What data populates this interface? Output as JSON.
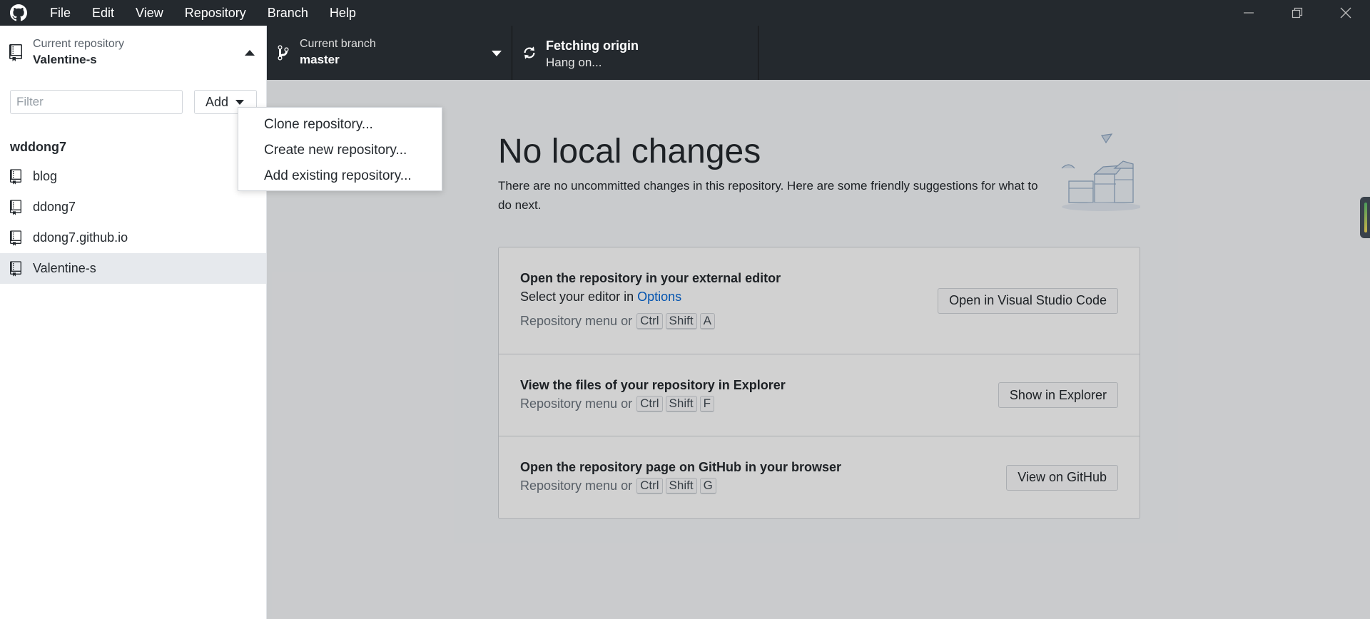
{
  "menu": [
    "File",
    "Edit",
    "View",
    "Repository",
    "Branch",
    "Help"
  ],
  "toolbar": {
    "repo_label": "Current repository",
    "repo_value": "Valentine-s",
    "branch_label": "Current branch",
    "branch_value": "master",
    "fetch_title": "Fetching origin",
    "fetch_sub": "Hang on..."
  },
  "sidebar": {
    "filter_placeholder": "Filter",
    "add_label": "Add",
    "group": "wddong7",
    "repos": [
      "blog",
      "ddong7",
      "ddong7.github.io",
      "Valentine-s"
    ],
    "selected": "Valentine-s"
  },
  "dropdown": [
    "Clone repository...",
    "Create new repository...",
    "Add existing repository..."
  ],
  "main": {
    "title": "No local changes",
    "description": "There are no uncommitted changes in this repository. Here are some friendly suggestions for what to do next.",
    "suggestions": [
      {
        "title": "Open the repository in your external editor",
        "sub_prefix": "Select your editor in ",
        "sub_link": "Options",
        "hint": "Repository menu or",
        "keys": [
          "Ctrl",
          "Shift",
          "A"
        ],
        "button": "Open in Visual Studio Code"
      },
      {
        "title": "View the files of your repository in Explorer",
        "hint": "Repository menu or",
        "keys": [
          "Ctrl",
          "Shift",
          "F"
        ],
        "button": "Show in Explorer"
      },
      {
        "title": "Open the repository page on GitHub in your browser",
        "hint": "Repository menu or",
        "keys": [
          "Ctrl",
          "Shift",
          "G"
        ],
        "button": "View on GitHub"
      }
    ]
  },
  "colors": {
    "titlebar": "#24292e",
    "link": "#0366d6",
    "selected_row": "#e6e9ed"
  }
}
